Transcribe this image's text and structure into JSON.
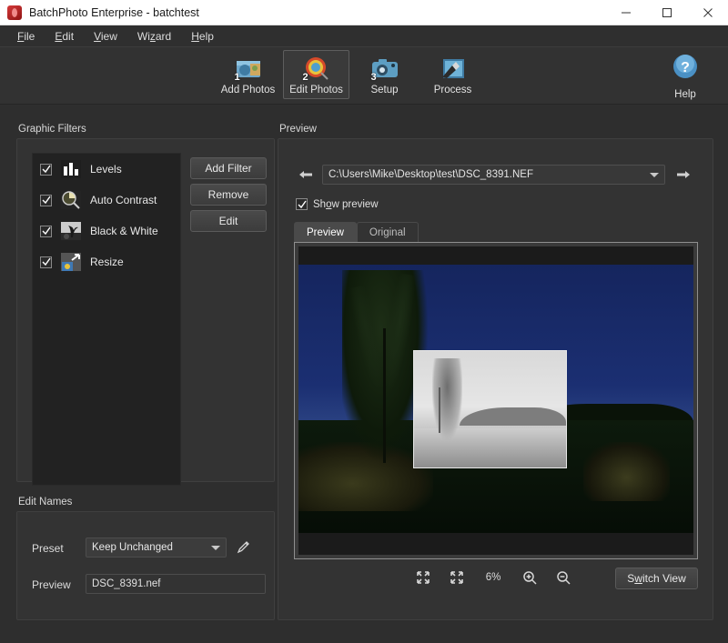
{
  "window": {
    "title": "BatchPhoto Enterprise - batchtest",
    "app_icon": "batchphoto-app-icon",
    "controls": {
      "minimize": "minimize-icon",
      "maximize": "maximize-icon",
      "close": "close-icon"
    }
  },
  "menubar": {
    "items": [
      {
        "label": "File",
        "mnemonic": "F"
      },
      {
        "label": "Edit",
        "mnemonic": "E"
      },
      {
        "label": "View",
        "mnemonic": "V"
      },
      {
        "label": "Wizard",
        "mnemonic": "z"
      },
      {
        "label": "Help",
        "mnemonic": "H"
      }
    ]
  },
  "toolbar": {
    "buttons": [
      {
        "label": "Add Photos",
        "step": "1",
        "icon": "add-photos-icon",
        "active": false
      },
      {
        "label": "Edit Photos",
        "step": "2",
        "icon": "edit-photos-icon",
        "active": true
      },
      {
        "label": "Setup",
        "step": "3",
        "icon": "setup-icon",
        "active": false
      },
      {
        "label": "Process",
        "step": "",
        "icon": "process-icon",
        "active": false
      }
    ],
    "help": {
      "label": "Help",
      "icon": "help-icon"
    }
  },
  "graphic_filters": {
    "group_label": "Graphic Filters",
    "filters": [
      {
        "name": "Levels",
        "checked": true,
        "icon": "levels-icon"
      },
      {
        "name": "Auto Contrast",
        "checked": true,
        "icon": "auto-contrast-icon"
      },
      {
        "name": "Black & White",
        "checked": true,
        "icon": "black-and-white-icon"
      },
      {
        "name": "Resize",
        "checked": true,
        "icon": "resize-icon"
      }
    ],
    "buttons": {
      "add": "Add Filter",
      "remove": "Remove",
      "edit": "Edit"
    }
  },
  "edit_names": {
    "group_label": "Edit Names",
    "preset_label": "Preset",
    "preset_value": "Keep Unchanged",
    "edit_icon": "pencil-icon",
    "preview_label": "Preview",
    "preview_value": "DSC_8391.nef"
  },
  "preview": {
    "group_label": "Preview",
    "back_icon": "arrow-left-icon",
    "forward_icon": "arrow-right-icon",
    "path": "C:\\Users\\Mike\\Desktop\\test\\DSC_8391.NEF",
    "show_preview_label": "Show preview",
    "show_preview_checked": true,
    "tabs": [
      {
        "label": "Preview",
        "active": true
      },
      {
        "label": "Original",
        "active": false
      }
    ],
    "zoom": {
      "fit_icon": "fit-to-window-icon",
      "actual_icon": "actual-size-icon",
      "level": "6%",
      "zoom_in_icon": "zoom-in-icon",
      "zoom_out_icon": "zoom-out-icon"
    },
    "switch_view_label": "Switch View"
  },
  "colors": {
    "window_bg": "#2e2e2e",
    "panel_bg": "#333333",
    "list_bg": "#222222",
    "text": "#e8e8e8",
    "titlebar_bg": "#ffffff",
    "accent_help": "#4a90c4"
  }
}
